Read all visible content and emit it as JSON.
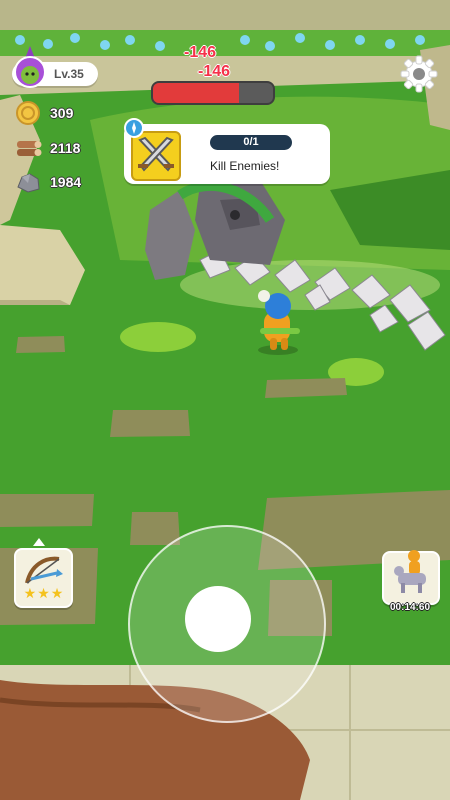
{
  "player": {
    "level_label": "Lv.35",
    "avatar_icon": "purple-wizard-avatar"
  },
  "resources": {
    "gold": "309",
    "wood": "2118",
    "stone": "1984"
  },
  "boss": {
    "health_fraction": 0.72,
    "damage_numbers": [
      "-146",
      "-146"
    ]
  },
  "quest": {
    "progress": "0/1",
    "title": "Kill Enemies!",
    "icon": "crossed-swords-icon"
  },
  "weapon": {
    "icon": "crossbow-icon",
    "stars": 3
  },
  "mount": {
    "icon": "mount-rider-icon",
    "timer": "00:14:60"
  },
  "colors": {
    "grass": "#46a12e",
    "health_red": "#e23b3b",
    "quest_bar": "#20384f",
    "hero_orange": "#f0a020",
    "hero_blue": "#2d7fd9"
  }
}
